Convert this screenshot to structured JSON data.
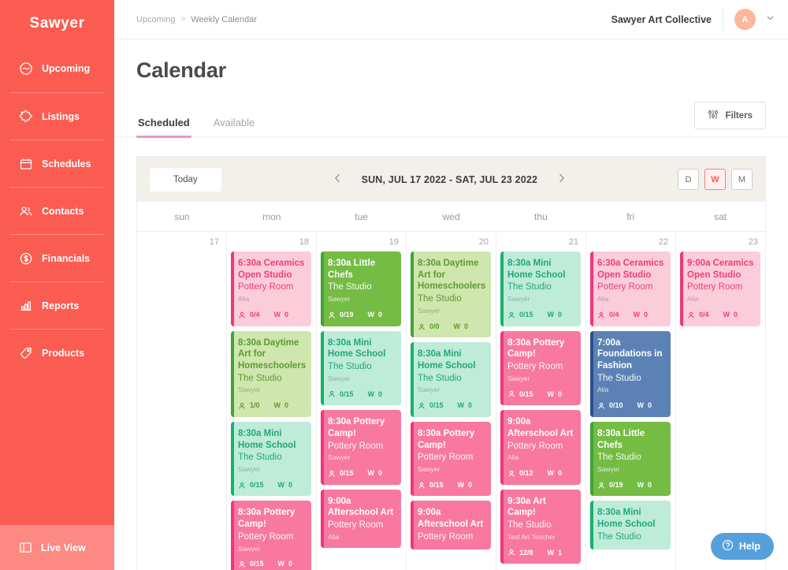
{
  "sidebar": {
    "brand": "Sawyer",
    "items": [
      {
        "label": "Upcoming",
        "icon": "upcoming-icon"
      },
      {
        "label": "Listings",
        "icon": "listings-icon"
      },
      {
        "label": "Schedules",
        "icon": "calendar-icon"
      },
      {
        "label": "Contacts",
        "icon": "contacts-icon"
      },
      {
        "label": "Financials",
        "icon": "dollar-circle-icon"
      },
      {
        "label": "Reports",
        "icon": "bar-chart-icon"
      },
      {
        "label": "Products",
        "icon": "tag-icon"
      }
    ],
    "live_view": {
      "label": "Live View",
      "icon": "live-view-icon"
    }
  },
  "topbar": {
    "breadcrumb": {
      "parent": "Upcoming",
      "separator": ">",
      "current": "Weekly Calendar"
    },
    "org_name": "Sawyer Art Collective",
    "avatar_initial": "A",
    "caret_icon": "chevron-down-icon"
  },
  "page": {
    "title": "Calendar",
    "tabs": [
      {
        "label": "Scheduled",
        "active": true
      },
      {
        "label": "Available",
        "active": false
      }
    ],
    "filters_button": {
      "label": "Filters",
      "icon": "sliders-icon"
    }
  },
  "calendar": {
    "today_button": "Today",
    "prev_icon": "chevron-left-icon",
    "next_icon": "chevron-right-icon",
    "range_label": "SUN, JUL 17 2022 - SAT, JUL 23 2022",
    "view_modes": [
      {
        "label": "D",
        "active": false
      },
      {
        "label": "W",
        "active": true
      },
      {
        "label": "M",
        "active": false
      }
    ],
    "day_headers": [
      "sun",
      "mon",
      "tue",
      "wed",
      "thu",
      "fri",
      "sat"
    ],
    "day_numbers": [
      "17",
      "18",
      "19",
      "20",
      "21",
      "22",
      "23"
    ],
    "meta_icons": {
      "attendee": "person-icon",
      "waitlist_label": "W"
    },
    "palette": {
      "pink_light_bg": "#FBCDDB",
      "pink_light_fg": "#EF3E78",
      "pink_light_accent": "#F2357B",
      "pink_bg": "#F878A0",
      "pink_fg": "#FFFFFF",
      "pink_accent": "#F2357B",
      "green_bg": "#74BC44",
      "green_fg": "#FFFFFF",
      "green_accent": "#3FA535",
      "green_light_bg": "#CFE6AE",
      "green_light_fg": "#5C9B2E",
      "green_light_accent": "#3FA535",
      "mint_bg": "#BFEBD9",
      "mint_fg": "#1FA97A",
      "mint_accent": "#17B26A",
      "blue_bg": "#5C82B5",
      "blue_fg": "#FFFFFF",
      "blue_accent": "#2F4D8A"
    },
    "days": [
      {
        "index": 0,
        "events": []
      },
      {
        "index": 1,
        "events": [
          {
            "time": "6:30a",
            "title": "Ceramics Open Studio",
            "room": "Pottery Room",
            "teacher": "Alia",
            "attendees": "0/4",
            "waitlist": "0",
            "theme": "pink_light"
          },
          {
            "time": "8:30a",
            "title": "Daytime Art for Homeschoolers",
            "room": "The Studio",
            "teacher": "Sawyer",
            "attendees": "1/0",
            "waitlist": "0",
            "theme": "green_light"
          },
          {
            "time": "8:30a",
            "title": "Mini Home School",
            "room": "The Studio",
            "teacher": "Sawyer",
            "attendees": "0/15",
            "waitlist": "0",
            "theme": "mint"
          },
          {
            "time": "8:30a",
            "title": "Pottery Camp!",
            "room": "Pottery Room",
            "teacher": "Sawyer",
            "attendees": "0/15",
            "waitlist": "0",
            "theme": "pink"
          }
        ]
      },
      {
        "index": 2,
        "events": [
          {
            "time": "8:30a",
            "title": "Little Chefs",
            "room": "The Studio",
            "teacher": "Sawyer",
            "attendees": "0/19",
            "waitlist": "0",
            "theme": "green"
          },
          {
            "time": "8:30a",
            "title": "Mini Home School",
            "room": "The Studio",
            "teacher": "Sawyer",
            "attendees": "0/15",
            "waitlist": "0",
            "theme": "mint"
          },
          {
            "time": "8:30a",
            "title": "Pottery Camp!",
            "room": "Pottery Room",
            "teacher": "Sawyer",
            "attendees": "0/15",
            "waitlist": "0",
            "theme": "pink"
          },
          {
            "time": "9:00a",
            "title": "Afterschool Art",
            "room": "Pottery Room",
            "teacher": "Alia",
            "attendees": "",
            "waitlist": "",
            "theme": "pink"
          }
        ]
      },
      {
        "index": 3,
        "events": [
          {
            "time": "8:30a",
            "title": "Daytime Art for Homeschoolers",
            "room": "The Studio",
            "teacher": "Sawyer",
            "attendees": "0/0",
            "waitlist": "0",
            "theme": "green_light"
          },
          {
            "time": "8:30a",
            "title": "Mini Home School",
            "room": "The Studio",
            "teacher": "Sawyer",
            "attendees": "0/15",
            "waitlist": "0",
            "theme": "mint"
          },
          {
            "time": "8:30a",
            "title": "Pottery Camp!",
            "room": "Pottery Room",
            "teacher": "Sawyer",
            "attendees": "0/15",
            "waitlist": "0",
            "theme": "pink"
          },
          {
            "time": "9:00a",
            "title": "Afterschool Art",
            "room": "Pottery Room",
            "teacher": "",
            "attendees": "",
            "waitlist": "",
            "theme": "pink"
          }
        ]
      },
      {
        "index": 4,
        "events": [
          {
            "time": "8:30a",
            "title": "Mini Home School",
            "room": "The Studio",
            "teacher": "Sawyer",
            "attendees": "0/15",
            "waitlist": "0",
            "theme": "mint"
          },
          {
            "time": "8:30a",
            "title": "Pottery Camp!",
            "room": "Pottery Room",
            "teacher": "Sawyer",
            "attendees": "0/15",
            "waitlist": "0",
            "theme": "pink"
          },
          {
            "time": "9:00a",
            "title": "Afterschool Art",
            "room": "Pottery Room",
            "teacher": "Alia",
            "attendees": "0/12",
            "waitlist": "0",
            "theme": "pink"
          },
          {
            "time": "9:30a",
            "title": "Art Camp!",
            "room": "The Studio",
            "teacher": "Test Art Teacher",
            "attendees": "12/8",
            "waitlist": "1",
            "theme": "pink"
          }
        ]
      },
      {
        "index": 5,
        "events": [
          {
            "time": "6:30a",
            "title": "Ceramics Open Studio",
            "room": "Pottery Room",
            "teacher": "Alia",
            "attendees": "0/4",
            "waitlist": "0",
            "theme": "pink_light"
          },
          {
            "time": "7:00a",
            "title": "Foundations in Fashion",
            "room": "The Studio",
            "teacher": "Alia",
            "attendees": "0/10",
            "waitlist": "0",
            "theme": "blue"
          },
          {
            "time": "8:30a",
            "title": "Little Chefs",
            "room": "The Studio",
            "teacher": "Sawyer",
            "attendees": "0/19",
            "waitlist": "0",
            "theme": "green"
          },
          {
            "time": "8:30a",
            "title": "Mini Home School",
            "room": "The Studio",
            "teacher": "",
            "attendees": "",
            "waitlist": "",
            "theme": "mint"
          }
        ]
      },
      {
        "index": 6,
        "events": [
          {
            "time": "9:00a",
            "title": "Ceramics Open Studio",
            "room": "Pottery Room",
            "teacher": "Alia",
            "attendees": "0/4",
            "waitlist": "0",
            "theme": "pink_light"
          }
        ]
      }
    ]
  },
  "help": {
    "label": "Help",
    "icon": "question-circle-icon"
  }
}
